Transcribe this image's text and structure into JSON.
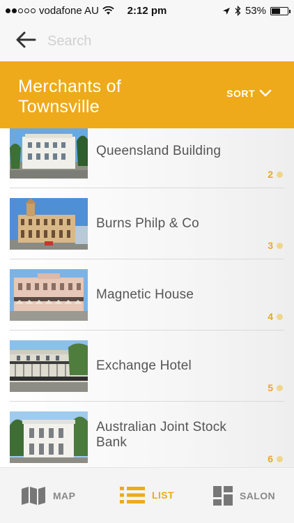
{
  "status_bar": {
    "carrier": "vodafone AU",
    "time": "2:12 pm",
    "battery": "53%",
    "battery_level": 0.53,
    "signal_bars_filled": 2,
    "signal_bars_total": 5
  },
  "search": {
    "placeholder": "Search"
  },
  "header": {
    "title": "Merchants of Townsville",
    "sort_label": "SORT"
  },
  "list": {
    "items": [
      {
        "name": "Queensland Building",
        "number": "2"
      },
      {
        "name": "Burns Philp & Co",
        "number": "3"
      },
      {
        "name": "Magnetic House",
        "number": "4"
      },
      {
        "name": "Exchange Hotel",
        "number": "5"
      },
      {
        "name": "Australian Joint Stock Bank",
        "number": "6"
      }
    ]
  },
  "bottom_nav": {
    "map_label": "MAP",
    "list_label": "LIST",
    "salon_label": "SALON"
  },
  "colors": {
    "accent": "#eeaa1a",
    "number": "#e9a91d"
  },
  "icons": {
    "back": "arrow-left-icon",
    "sort": "chevron-down-icon",
    "map": "map-icon",
    "list": "list-icon",
    "salon": "grid-icon"
  }
}
